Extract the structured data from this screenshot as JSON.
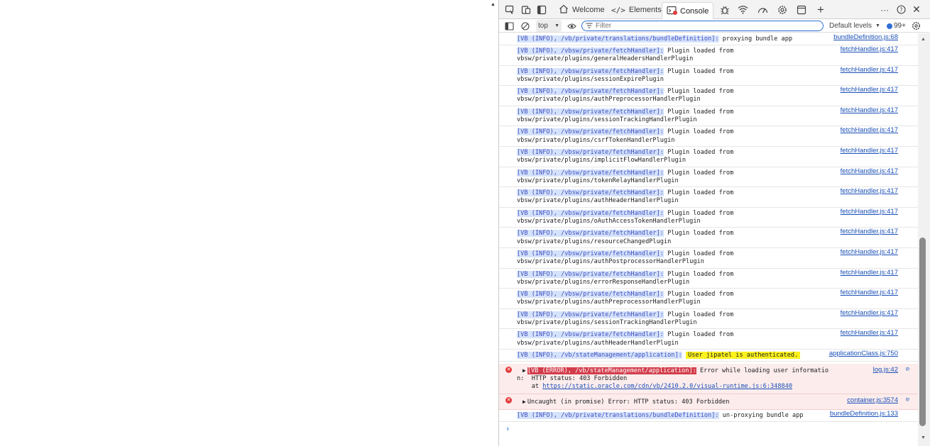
{
  "devtools": {
    "tabs": [
      {
        "label": "Welcome",
        "icon": "home-icon"
      },
      {
        "label": "Elements",
        "icon": "code-icon"
      },
      {
        "label": "Console",
        "icon": "console-icon",
        "active": true
      }
    ],
    "toolbar_icons": [
      "inspect-icon",
      "device-emulation-icon",
      "sidebar-toggle-icon",
      "bug-icon",
      "wifi-icon",
      "performance-icon",
      "settings-gear-icon",
      "application-icon",
      "add-tab-icon",
      "more-options-icon",
      "help-icon",
      "close-icon"
    ]
  },
  "console_toolbar": {
    "context": "top",
    "filter_placeholder": "Filter",
    "levels": "Default levels",
    "issues_count": "99+"
  },
  "messages": [
    {
      "prefix": "[VB (INFO), /vb/private/translations/bundleDefinition]:",
      "text": " proxying bundle app",
      "source": "bundleDefinition.js:68"
    },
    {
      "prefix": "[VB (INFO), /vbsw/private/fetchHandler]:",
      "text": " Plugin loaded from",
      "text2": "vbsw/private/plugins/generalHeadersHandlerPlugin",
      "source": "fetchHandler.js:417"
    },
    {
      "prefix": "[VB (INFO), /vbsw/private/fetchHandler]:",
      "text": " Plugin loaded from",
      "text2": "vbsw/private/plugins/sessionExpirePlugin",
      "source": "fetchHandler.js:417"
    },
    {
      "prefix": "[VB (INFO), /vbsw/private/fetchHandler]:",
      "text": " Plugin loaded from",
      "text2": "vbsw/private/plugins/authPreprocessorHandlerPlugin",
      "source": "fetchHandler.js:417"
    },
    {
      "prefix": "[VB (INFO), /vbsw/private/fetchHandler]:",
      "text": " Plugin loaded from",
      "text2": "vbsw/private/plugins/sessionTrackingHandlerPlugin",
      "source": "fetchHandler.js:417"
    },
    {
      "prefix": "[VB (INFO), /vbsw/private/fetchHandler]:",
      "text": " Plugin loaded from",
      "text2": "vbsw/private/plugins/csrfTokenHandlerPlugin",
      "source": "fetchHandler.js:417"
    },
    {
      "prefix": "[VB (INFO), /vbsw/private/fetchHandler]:",
      "text": " Plugin loaded from",
      "text2": "vbsw/private/plugins/implicitFlowHandlerPlugin",
      "source": "fetchHandler.js:417"
    },
    {
      "prefix": "[VB (INFO), /vbsw/private/fetchHandler]:",
      "text": " Plugin loaded from",
      "text2": "vbsw/private/plugins/tokenRelayHandlerPlugin",
      "source": "fetchHandler.js:417"
    },
    {
      "prefix": "[VB (INFO), /vbsw/private/fetchHandler]:",
      "text": " Plugin loaded from",
      "text2": "vbsw/private/plugins/authHeaderHandlerPlugin",
      "source": "fetchHandler.js:417"
    },
    {
      "prefix": "[VB (INFO), /vbsw/private/fetchHandler]:",
      "text": " Plugin loaded from",
      "text2": "vbsw/private/plugins/oAuthAccessTokenHandlerPlugin",
      "source": "fetchHandler.js:417"
    },
    {
      "prefix": "[VB (INFO), /vbsw/private/fetchHandler]:",
      "text": " Plugin loaded from",
      "text2": "vbsw/private/plugins/resourceChangedPlugin",
      "source": "fetchHandler.js:417"
    },
    {
      "prefix": "[VB (INFO), /vbsw/private/fetchHandler]:",
      "text": " Plugin loaded from",
      "text2": "vbsw/private/plugins/authPostprocessorHandlerPlugin",
      "source": "fetchHandler.js:417"
    },
    {
      "prefix": "[VB (INFO), /vbsw/private/fetchHandler]:",
      "text": " Plugin loaded from",
      "text2": "vbsw/private/plugins/errorResponseHandlerPlugin",
      "source": "fetchHandler.js:417"
    },
    {
      "prefix": "[VB (INFO), /vbsw/private/fetchHandler]:",
      "text": " Plugin loaded from",
      "text2": "vbsw/private/plugins/authPreprocessorHandlerPlugin",
      "source": "fetchHandler.js:417"
    },
    {
      "prefix": "[VB (INFO), /vbsw/private/fetchHandler]:",
      "text": " Plugin loaded from",
      "text2": "vbsw/private/plugins/sessionTrackingHandlerPlugin",
      "source": "fetchHandler.js:417"
    },
    {
      "prefix": "[VB (INFO), /vbsw/private/fetchHandler]:",
      "text": " Plugin loaded from",
      "text2": "vbsw/private/plugins/authHeaderHandlerPlugin",
      "source": "fetchHandler.js:417"
    }
  ],
  "auth_message": {
    "prefix": "[VB (INFO), /vb/stateManagement/application]:",
    "text": "User jipatel is authenticated.",
    "source": "applicationClass.js:750"
  },
  "error_message": {
    "prefix": "[VB (ERROR), /vb/stateManagement/application]:",
    "text": " Error while loading user informatio",
    "line2": "n:  HTTP status: 403 Forbidden",
    "line3": "    at ",
    "link": "https://static.oracle.com/cdn/vb/2410.2.0/visual-runtime.js:6:348840",
    "source": "log.js:42"
  },
  "uncaught_message": {
    "text": "Uncaught (in promise) Error:  HTTP status: 403 Forbidden",
    "source": "container.js:3574"
  },
  "last_message": {
    "prefix": "[VB (INFO), /vb/private/translations/bundleDefinition]:",
    "text": " un-proxying bundle app",
    "source": "bundleDefinition.js:133"
  }
}
